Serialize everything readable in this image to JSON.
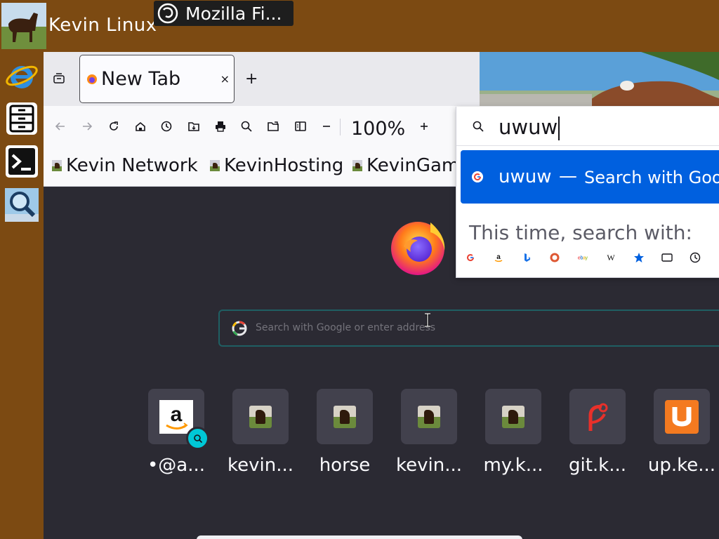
{
  "desktop": {
    "user_name": "Kevin Linux",
    "taskbar_window_title": "Mozilla Fi..."
  },
  "browser": {
    "tab": {
      "title": "New Tab",
      "close_label": "×",
      "new_tab_label": "+"
    },
    "toolbar": {
      "zoom_level": "100%"
    },
    "bookmarks": [
      "Kevin Network",
      "KevinHosting",
      "KevinGam"
    ],
    "search": {
      "placeholder": "Search with Google or enter address"
    },
    "urlbar": {
      "value": "uwuw",
      "suggestion_text": "uwuw",
      "suggestion_separator": "—",
      "suggestion_action": "Search with Goo",
      "oneoff_label": "This time, search with:",
      "engines": [
        "google",
        "amazon",
        "bing",
        "duckduckgo",
        "ebay",
        "wikipedia",
        "bookmarks",
        "tabs",
        "history"
      ]
    },
    "top_sites": [
      {
        "label": "•@a...",
        "icon": "amazon"
      },
      {
        "label": "kevin...",
        "icon": "horse"
      },
      {
        "label": "horse",
        "icon": "horse"
      },
      {
        "label": "kevin...",
        "icon": "horse"
      },
      {
        "label": "my.k...",
        "icon": "horse"
      },
      {
        "label": "git.k...",
        "icon": "git"
      },
      {
        "label": "up.ke...",
        "icon": "up"
      }
    ]
  },
  "colors": {
    "panel": "#7c4a12",
    "content_bg": "#2b2a33",
    "accent": "#0060df",
    "tile_bg": "#42414d"
  }
}
